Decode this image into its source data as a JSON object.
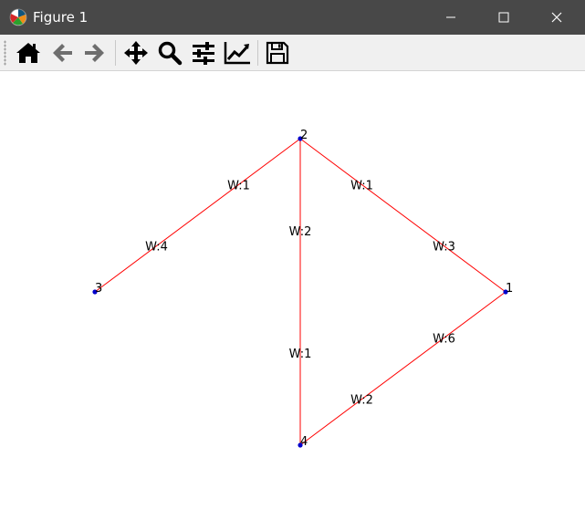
{
  "window": {
    "title": "Figure 1",
    "icon": "matplotlib-logo-icon",
    "controls": [
      "minimize-icon",
      "maximize-icon",
      "close-icon"
    ]
  },
  "toolbar": {
    "buttons": [
      {
        "name": "home-button",
        "icon": "home-icon"
      },
      {
        "name": "back-button",
        "icon": "arrow-left-icon"
      },
      {
        "name": "forward-button",
        "icon": "arrow-right-icon"
      },
      {
        "name": "pan-button",
        "icon": "move-icon"
      },
      {
        "name": "zoom-button",
        "icon": "magnifier-icon"
      },
      {
        "name": "configure-subplots-button",
        "icon": "sliders-icon"
      },
      {
        "name": "edit-axes-button",
        "icon": "line-chart-icon"
      },
      {
        "name": "save-button",
        "icon": "floppy-disk-icon"
      }
    ]
  },
  "graph": {
    "edge_color": "#ff0000",
    "node_color": "#0000cc",
    "nodes": [
      {
        "id": "1",
        "label": "1"
      },
      {
        "id": "2",
        "label": "2"
      },
      {
        "id": "3",
        "label": "3"
      },
      {
        "id": "4",
        "label": "4"
      }
    ],
    "edges": [
      {
        "from": "2",
        "to": "3",
        "labels": [
          "W:1",
          "W:4"
        ]
      },
      {
        "from": "2",
        "to": "1",
        "labels": [
          "W:1",
          "W:3"
        ]
      },
      {
        "from": "2",
        "to": "4",
        "labels": [
          "W:2",
          "W:1"
        ]
      },
      {
        "from": "1",
        "to": "4",
        "labels": [
          "W:6",
          "W:2"
        ]
      }
    ]
  }
}
